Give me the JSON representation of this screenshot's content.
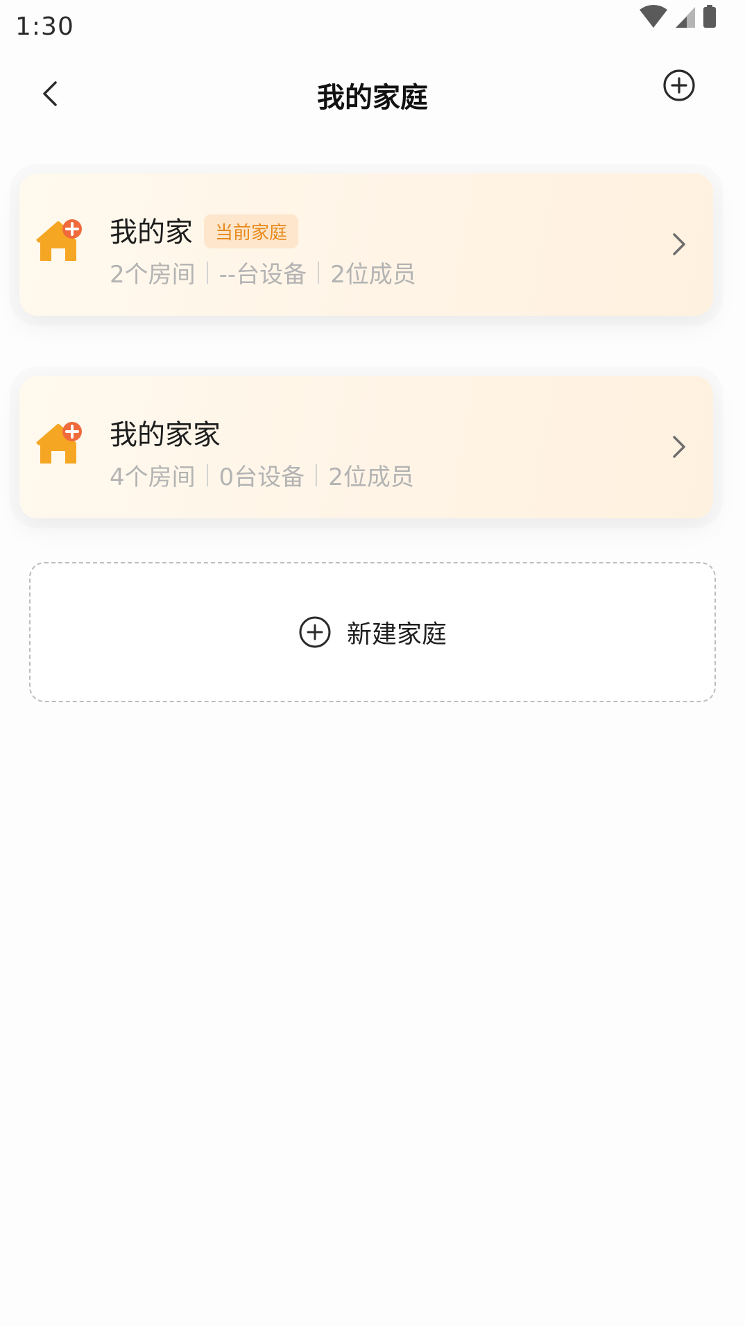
{
  "status_bar": {
    "time": "1:30",
    "icons": [
      "wifi-icon",
      "signal-icon",
      "battery-icon"
    ]
  },
  "header": {
    "title": "我的家庭",
    "back_icon": "chevron-left-icon",
    "add_icon": "plus-circle-icon"
  },
  "homes": [
    {
      "name": "我的家",
      "badge": "当前家庭",
      "rooms": "2个房间",
      "devices": "--台设备",
      "members": "2位成员",
      "icon": "home-add-icon"
    },
    {
      "name": "我的家家",
      "badge": "",
      "rooms": "4个房间",
      "devices": "0台设备",
      "members": "2位成员",
      "icon": "home-add-icon"
    }
  ],
  "new_home": {
    "label": "新建家庭",
    "icon": "plus-circle-icon"
  },
  "colors": {
    "accent": "#f5a623",
    "badge_text": "#e8891c",
    "badge_bg": "#fde6cc",
    "card_bg": "#fff5e8",
    "stat_text": "#b3b3b3"
  }
}
